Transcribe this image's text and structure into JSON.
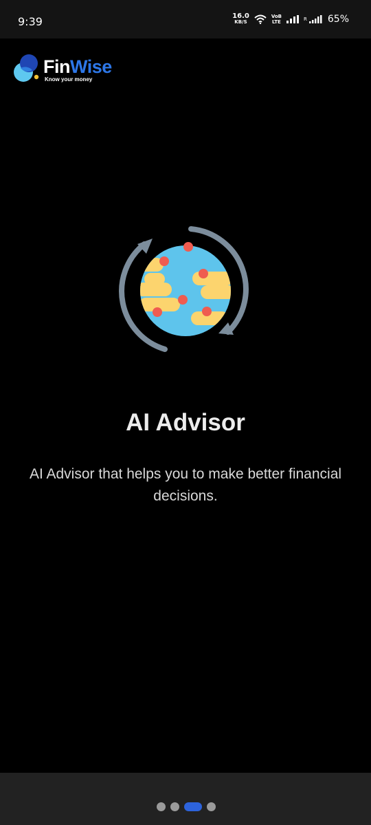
{
  "status_bar": {
    "time": "9:39",
    "net_speed_value": "16.0",
    "net_speed_unit": "KB/S",
    "volte_top": "VoB",
    "volte_bottom": "LTE",
    "roaming": "R",
    "battery": "65%"
  },
  "brand": {
    "name_part1": "Fin",
    "name_part2": "Wise",
    "tagline": "Know your money",
    "accent_color": "#2d77e8"
  },
  "onboarding": {
    "illustration": "globe-sync-icon",
    "title": "AI Advisor",
    "description": "AI Advisor that helps you to make better financial decisions."
  },
  "pager": {
    "page_count": 4,
    "active_page": 3,
    "active_color": "#2d63dc",
    "inactive_color": "#9a9a9a"
  }
}
